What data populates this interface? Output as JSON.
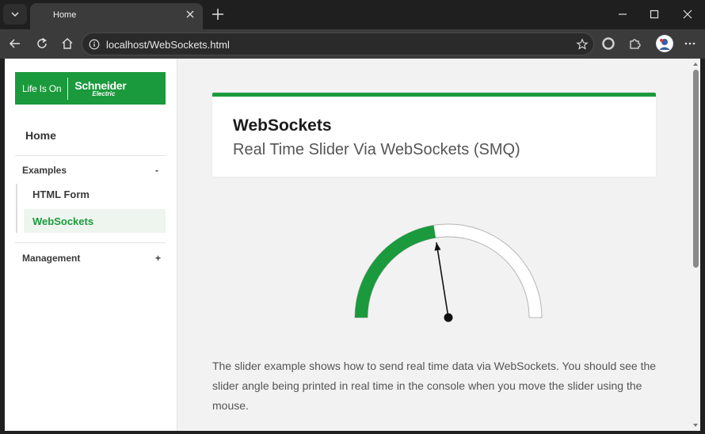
{
  "browser": {
    "tab_title": "Home",
    "url": "localhost/WebSockets.html"
  },
  "sidebar": {
    "logo_text": "Life Is On",
    "logo_brand": "Schneider",
    "logo_brand_sub": "Electric",
    "home": "Home",
    "groups": [
      {
        "label": "Examples",
        "toggle": "-",
        "items": [
          {
            "label": "HTML Form",
            "active": false
          },
          {
            "label": "WebSockets",
            "active": true
          }
        ]
      },
      {
        "label": "Management",
        "toggle": "+"
      }
    ]
  },
  "main": {
    "title": "WebSockets",
    "subtitle": "Real Time Slider Via WebSockets (SMQ)",
    "description": "The slider example shows how to send real time data via WebSockets. You should see the slider angle being printed in real time in the console when you move the slider using the mouse."
  },
  "slider": {
    "fraction": 0.45
  },
  "colors": {
    "accent": "#1a9a3c",
    "active_bg": "#eef5ee",
    "text": "#555555"
  },
  "icons": [
    "tab-menu-icon",
    "close-icon",
    "plus-icon",
    "minimize-icon",
    "maximize-icon",
    "back-icon",
    "reload-icon",
    "home-icon",
    "info-icon",
    "star-icon",
    "circle-icon",
    "extension-icon",
    "avatar",
    "more-icon"
  ]
}
